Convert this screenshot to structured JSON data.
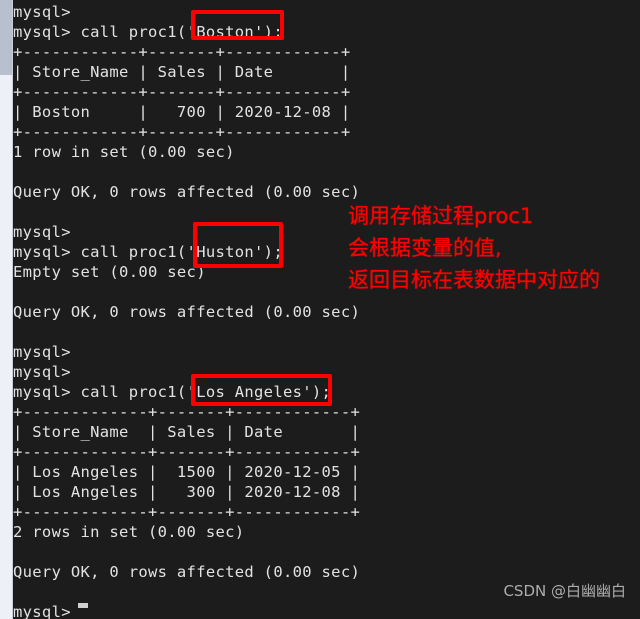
{
  "window": {
    "type": "mysql-terminal",
    "background_color": "#1c1c1c",
    "text_color": "#e2e2e2"
  },
  "scrollbar": {
    "track_color": "#eef0f7",
    "thumb_color": "#b8c0ce"
  },
  "terminal": {
    "prompt": "mysql>",
    "lines": [
      "mysql>",
      "mysql> call proc1('Boston');",
      "+------------+-------+------------+",
      "| Store_Name | Sales | Date       |",
      "+------------+-------+------------+",
      "| Boston     |   700 | 2020-12-08 |",
      "+------------+-------+------------+",
      "1 row in set (0.00 sec)",
      "",
      "Query OK, 0 rows affected (0.00 sec)",
      "",
      "mysql>",
      "mysql> call proc1('Huston');",
      "Empty set (0.00 sec)",
      "",
      "Query OK, 0 rows affected (0.00 sec)",
      "",
      "mysql>",
      "mysql>",
      "mysql> call proc1('Los Angeles');",
      "+-------------+-------+------------+",
      "| Store_Name  | Sales | Date       |",
      "+-------------+-------+------------+",
      "| Los Angeles |  1500 | 2020-12-05 |",
      "| Los Angeles |   300 | 2020-12-08 |",
      "+-------------+-------+------------+",
      "2 rows in set (0.00 sec)",
      "",
      "Query OK, 0 rows affected (0.00 sec)",
      "",
      "mysql>"
    ],
    "queries": [
      {
        "command": "call proc1('Boston');",
        "argument": "'Boston'",
        "result_type": "table",
        "columns": [
          "Store_Name",
          "Sales",
          "Date"
        ],
        "rows": [
          [
            "Boston",
            "700",
            "2020-12-08"
          ]
        ],
        "status": "1 row in set (0.00 sec)",
        "followup": "Query OK, 0 rows affected (0.00 sec)"
      },
      {
        "command": "call proc1('Huston');",
        "argument": "'Huston'",
        "result_type": "empty",
        "status": "Empty set (0.00 sec)",
        "followup": "Query OK, 0 rows affected (0.00 sec)"
      },
      {
        "command": "call proc1('Los Angeles');",
        "argument": "'Los Angeles'",
        "result_type": "table",
        "columns": [
          "Store_Name",
          "Sales",
          "Date"
        ],
        "rows": [
          [
            "Los Angeles",
            "1500",
            "2020-12-05"
          ],
          [
            "Los Angeles",
            "300",
            "2020-12-08"
          ]
        ],
        "status": "2 rows in set (0.00 sec)",
        "followup": "Query OK, 0 rows affected (0.00 sec)"
      }
    ]
  },
  "annotations": {
    "color": "#ff0000",
    "note_lines": [
      "调用存储过程proc1",
      "会根据变量的值,",
      "返回目标在表数据中对应的"
    ],
    "highlight_boxes": [
      {
        "name": "boston",
        "label": "'Boston'"
      },
      {
        "name": "huston",
        "label": "'Huston'"
      },
      {
        "name": "los-angeles",
        "label": "'Los Angeles'"
      }
    ]
  },
  "watermark": {
    "text": "CSDN @白幽幽白"
  }
}
